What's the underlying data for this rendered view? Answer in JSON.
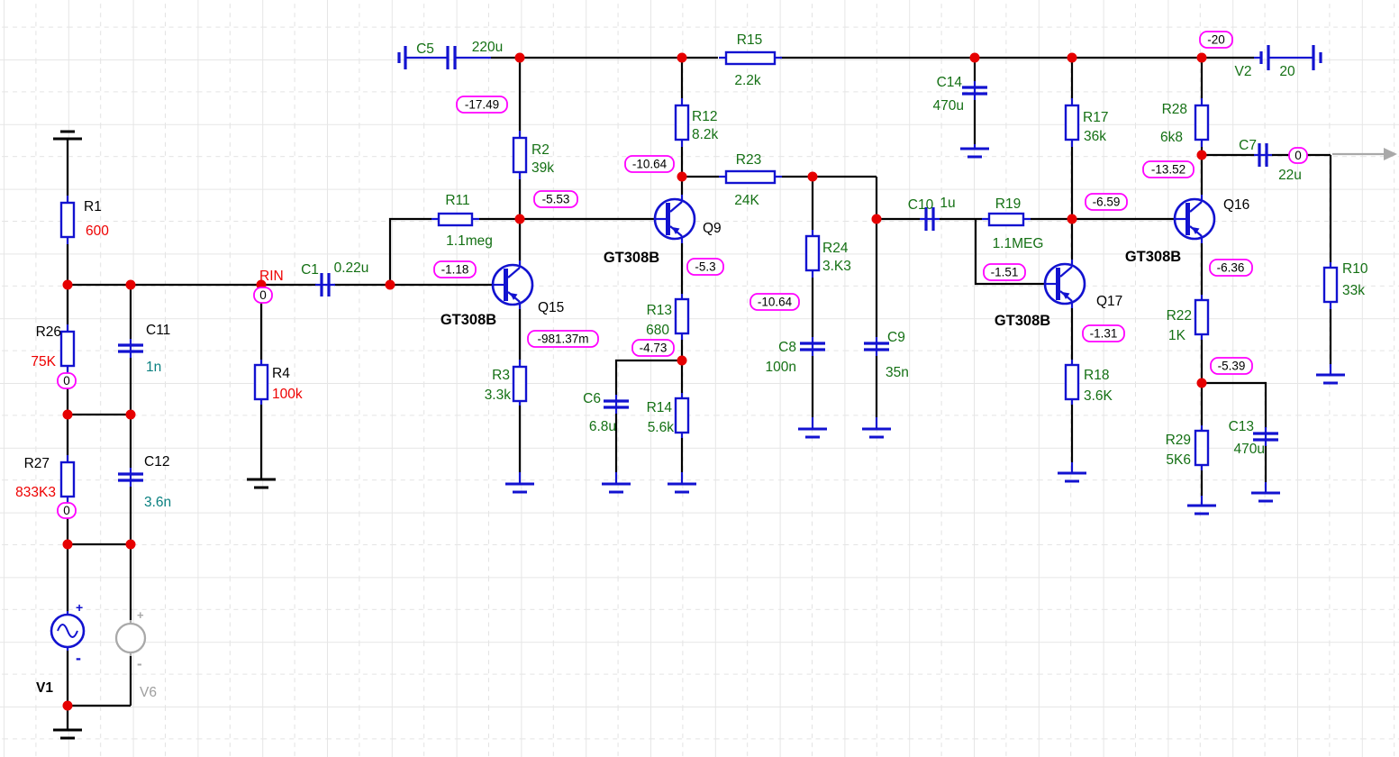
{
  "components": {
    "R1": {
      "name": "R1",
      "value": "600"
    },
    "R26": {
      "name": "R26",
      "value": "75K"
    },
    "R27": {
      "name": "R27",
      "value": "833K3"
    },
    "C11": {
      "name": "C11",
      "value": "1n"
    },
    "C12": {
      "name": "C12",
      "value": "3.6n"
    },
    "R4": {
      "name": "R4",
      "value": "100k"
    },
    "V1": {
      "name": "V1"
    },
    "V6": {
      "name": "V6"
    },
    "C1": {
      "name": "C1",
      "value": "0.22u"
    },
    "R11": {
      "name": "R11",
      "value": "1.1meg"
    },
    "R2": {
      "name": "R2",
      "value": "39k"
    },
    "C5": {
      "name": "C5",
      "value": "220u"
    },
    "R15": {
      "name": "R15",
      "value": "2.2k"
    },
    "R12": {
      "name": "R12",
      "value": "8.2k"
    },
    "R23": {
      "name": "R23",
      "value": "24K"
    },
    "Q15": {
      "name": "Q15",
      "part": "GT308B"
    },
    "Q9": {
      "name": "Q9",
      "part": "GT308B"
    },
    "R3": {
      "name": "R3",
      "value": "3.3k"
    },
    "R13": {
      "name": "R13",
      "value": "680"
    },
    "R14": {
      "name": "R14",
      "value": "5.6k"
    },
    "C6": {
      "name": "C6",
      "value": "6.8u"
    },
    "R24": {
      "name": "R24",
      "value": "3.K3"
    },
    "C8": {
      "name": "C8",
      "value": "100n"
    },
    "C9": {
      "name": "C9",
      "value": "35n"
    },
    "C10": {
      "name": "C10",
      "value": "1u"
    },
    "R19": {
      "name": "R19",
      "value": "1.1MEG"
    },
    "Q17": {
      "name": "Q17",
      "part": "GT308B"
    },
    "R18": {
      "name": "R18",
      "value": "3.6K"
    },
    "C14": {
      "name": "C14",
      "value": "470u"
    },
    "R17": {
      "name": "R17",
      "value": "36k"
    },
    "R28": {
      "name": "R28",
      "value": "6k8"
    },
    "V2": {
      "name": "V2",
      "value": "20"
    },
    "C7": {
      "name": "C7",
      "value": "22u"
    },
    "Q16": {
      "name": "Q16",
      "part": "GT308B"
    },
    "R22": {
      "name": "R22",
      "value": "1K"
    },
    "R10": {
      "name": "R10",
      "value": "33k"
    },
    "R29": {
      "name": "R29",
      "value": "5K6"
    },
    "C13": {
      "name": "C13",
      "value": "470u"
    }
  },
  "nets": {
    "rin": "RIN"
  },
  "probes": {
    "rail_left": "-17.49",
    "q15_collector": "-5.53",
    "q15_base": "-1.18",
    "q15_emitter": "-981.37m",
    "rin_dc": "0",
    "r26_bottom": "0",
    "r27_bottom": "0",
    "q9_collector": "-10.64",
    "q9_emitter": "-5.3",
    "r13_bottom": "-4.73",
    "r24_bottom": "-10.64",
    "q17_collector": "-6.59",
    "q17_base": "-1.51",
    "q17_emitter": "-1.31",
    "rail_right": "-20",
    "q16_collector": "-13.52",
    "q16_emitter": "-6.36",
    "r22_bottom": "-5.39",
    "output_dc": "0"
  },
  "symbols": {
    "plus": "+",
    "minus": "-"
  },
  "colors": {
    "component_blue": "#1212d0",
    "wire_black": "#000000",
    "junction_red": "#e60000",
    "probe_magenta": "#ff00ff",
    "value_green": "#147014",
    "value_red": "#ee0000",
    "value_teal": "#0a8080",
    "inactive_gray": "#9e9e9e"
  }
}
